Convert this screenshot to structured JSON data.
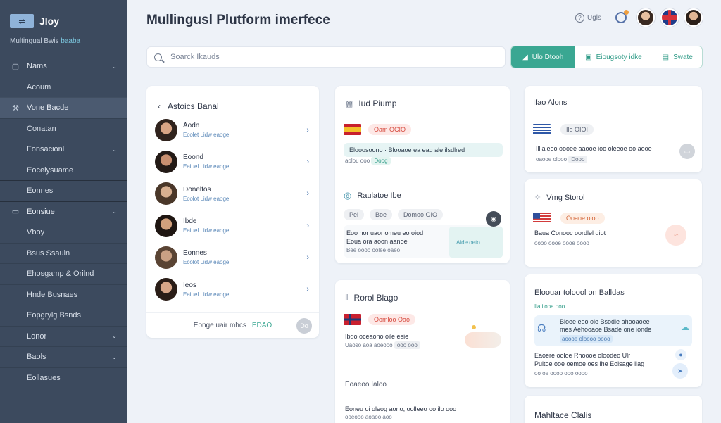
{
  "brand": {
    "title": "Jloy",
    "subtitle": "Multingual Bwis",
    "subtitle_accent": "baaba"
  },
  "sidebar": {
    "items": [
      {
        "label": "Nams",
        "icon": "square-icon",
        "chevron": true,
        "active": false,
        "sub": false
      },
      {
        "label": "Acoum",
        "icon": "",
        "chevron": false,
        "active": false,
        "sub": true
      },
      {
        "label": "Vone Bacde",
        "icon": "wrench-icon",
        "chevron": false,
        "active": true,
        "sub": false
      },
      {
        "label": "Conatan",
        "icon": "",
        "chevron": false,
        "active": false,
        "sub": true
      },
      {
        "label": "Fonsacionl",
        "icon": "",
        "chevron": true,
        "active": false,
        "sub": true
      },
      {
        "label": "Eocelysuame",
        "icon": "",
        "chevron": false,
        "active": false,
        "sub": true
      },
      {
        "label": "Eonnes",
        "icon": "",
        "chevron": false,
        "active": false,
        "sub": true
      },
      {
        "label": "Eonsiue",
        "icon": "monitor-icon",
        "chevron": true,
        "active": false,
        "sub": false
      },
      {
        "label": "Vboy",
        "icon": "",
        "chevron": false,
        "active": false,
        "sub": true
      },
      {
        "label": "Bsus Ssauin",
        "icon": "",
        "chevron": false,
        "active": false,
        "sub": true
      },
      {
        "label": "Ehosgamp & Orilnd",
        "icon": "",
        "chevron": false,
        "active": false,
        "sub": true
      },
      {
        "label": "Hnde Busnaes",
        "icon": "",
        "chevron": false,
        "active": false,
        "sub": true
      },
      {
        "label": "Eopgrylg Bsnds",
        "icon": "",
        "chevron": false,
        "active": false,
        "sub": true
      },
      {
        "label": "Lonor",
        "icon": "",
        "chevron": true,
        "active": false,
        "sub": true
      },
      {
        "label": "Baols",
        "icon": "",
        "chevron": true,
        "active": false,
        "sub": true
      },
      {
        "label": "Eollasues",
        "icon": "",
        "chevron": false,
        "active": false,
        "sub": true
      }
    ]
  },
  "header": {
    "title": "Mullingusl Plutform imerfece",
    "help_label": "Ugls"
  },
  "search": {
    "placeholder": "Soarck Ikauds"
  },
  "toolbar": {
    "btn1": "Ulo Dtooh",
    "btn2": "Eiougsoty idke",
    "btn3": "Swate"
  },
  "contacts": {
    "title": "Astoics Banal",
    "items": [
      {
        "name": "Aodn",
        "sub": "Ecolet Lidw eaoge"
      },
      {
        "name": "Eoond",
        "sub": "Eaiuel Lidw eaoge"
      },
      {
        "name": "Donelfos",
        "sub": "Ecolot Lidw eaoge"
      },
      {
        "name": "Ibde",
        "sub": "Eaiuel Lidw eaoge"
      },
      {
        "name": "Eonnes",
        "sub": "Ecolot Lidw eaoge"
      },
      {
        "name": "Ieos",
        "sub": "Eaiuel Lidw eaoge"
      }
    ],
    "footer_text": "Eonge uair mhcs",
    "footer_link": "EDAO",
    "footer_more": "Do"
  },
  "card_es": {
    "title": "Iud Piump",
    "pill": "Oam OCIO",
    "bubble": "Elooosoono · Blooaoe ea eag ale ilsdlred",
    "meta1": "aolou ooo",
    "meta2": "Doog",
    "section2_title": "Raulatoe Ibe",
    "chips": [
      "Pel",
      "Boe",
      "Domoo OIO"
    ],
    "msg": "Eoo hor uaor omeu eo oiod",
    "msg2": "Eoua ora aoon aanoe",
    "meta3": "Bee oooo oolee oaeo",
    "right_note": "Aide oeto"
  },
  "card_no": {
    "title": "Rorol Blago",
    "pill": "Oomloo Oao",
    "msg": "Ibdo oceaono oile esie",
    "meta": "Uaoso aoa aoeooo",
    "meta_chip": "ooo ooo",
    "section2": "Eoaeoo Ialoo",
    "msg2": "Eoneu oi oleog aono, oolleeo oo ilo ooo",
    "meta2": "ooeooo aoaoo aoo"
  },
  "card_gr": {
    "title": "Ifao Alons",
    "pill": "Ilo OIOI",
    "msg": "Illlaleoo oooee aaooe ioo oleeoe oo aooe",
    "meta": "oaooe olooo",
    "meta_chip": "Dooo"
  },
  "card_us": {
    "title": "Vmg Storol",
    "pill": "Ooaoe oioo",
    "msg": "Baua Conooc oordlel diot",
    "meta": "oooo oooe oooe oooo"
  },
  "card_tr": {
    "title": "Eloouar toloool on Balldas",
    "subline": "Ila ilooa ooo",
    "bubble1": "Bloee eoo oie Bsodle ahooaoee",
    "bubble2": "mes Aehooaoe Bsade one ionde",
    "bubble_meta": "aoooe oloooo oooo",
    "msg": "Eaoere ooloe Rhoooe oloodeo Ulr",
    "msg2": "Pultoe ooe oemoe oes ihe Eolsage ilag",
    "meta": "oo oe oooo ooo oooo"
  },
  "card_last": {
    "title": "Mahltace Clalis"
  },
  "colors": {
    "sidebar": "#3c4a5e",
    "accent": "#3aa792",
    "background": "#eef2f8"
  }
}
